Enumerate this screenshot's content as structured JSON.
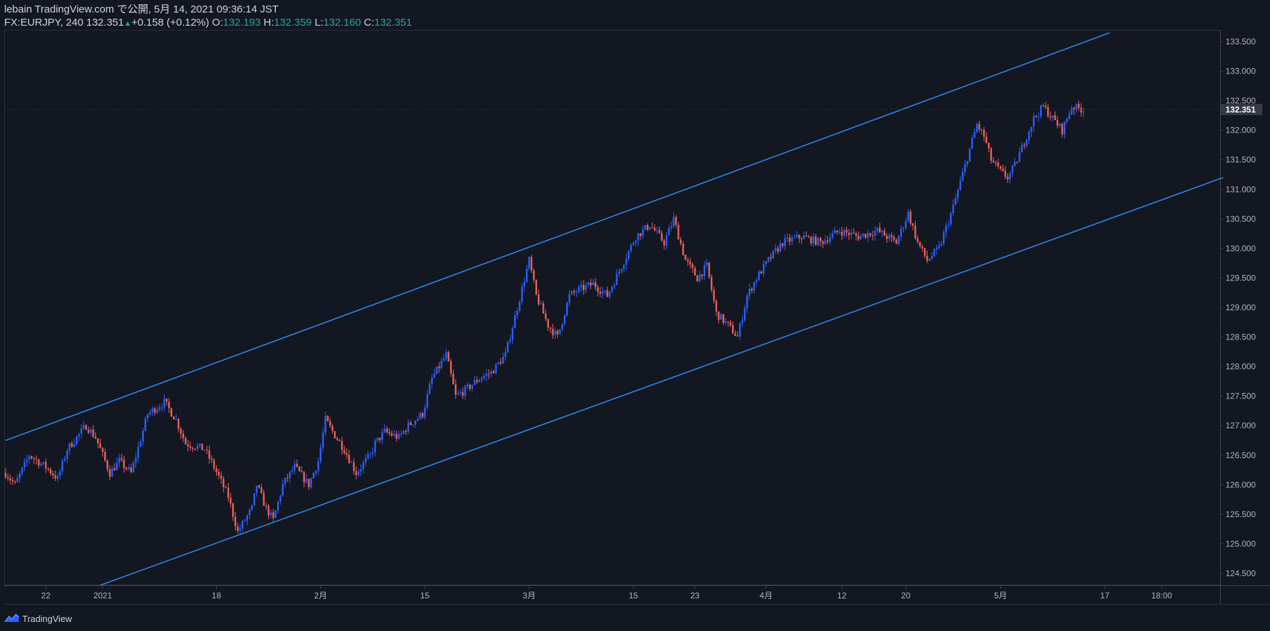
{
  "header": {
    "line1": "lebain TradingView.com で公開, 5月 14, 2021 09:36:14 JST",
    "symbol": "FX:EURJPY, 240",
    "last": "132.351",
    "up_arrow": "▲",
    "change": "+0.158 (+0.12%)",
    "o_label": "O:",
    "o_value": "132.193",
    "h_label": "H:",
    "h_value": "132.359",
    "l_label": "L:",
    "l_value": "132.160",
    "c_label": "C:",
    "c_value": "132.351"
  },
  "footer": {
    "brand": "TradingView",
    "logo_icon": "tradingview-logo-icon"
  },
  "colors": {
    "background": "#131722",
    "up": "#2962ff",
    "down": "#f0625a",
    "channel": "#2f86e4",
    "axis_text": "#b2b5be",
    "price_label_bg": "#363a45"
  },
  "chart_data": {
    "type": "candlestick",
    "symbol": "FX:EURJPY",
    "interval": "240",
    "ylim": [
      124.3,
      133.7
    ],
    "yticks": [
      "124.500",
      "125.000",
      "125.500",
      "126.000",
      "126.500",
      "127.000",
      "127.500",
      "128.000",
      "128.500",
      "129.000",
      "129.500",
      "130.000",
      "130.500",
      "131.000",
      "131.500",
      "132.000",
      "132.500",
      "133.000",
      "133.500"
    ],
    "xticks": [
      {
        "label": "22",
        "idx": 17
      },
      {
        "label": "2021",
        "idx": 41
      },
      {
        "label": "18",
        "idx": 89
      },
      {
        "label": "2月",
        "idx": 133
      },
      {
        "label": "15",
        "idx": 177
      },
      {
        "label": "3月",
        "idx": 221
      },
      {
        "label": "15",
        "idx": 265
      },
      {
        "label": "23",
        "idx": 291
      },
      {
        "label": "4月",
        "idx": 321
      },
      {
        "label": "12",
        "idx": 353
      },
      {
        "label": "20",
        "idx": 380
      },
      {
        "label": "5月",
        "idx": 420
      },
      {
        "label": "17",
        "idx": 464
      },
      {
        "label": "18:00",
        "idx": 488
      }
    ],
    "last_price": "132.351",
    "channel_upper": {
      "start_idx": 0,
      "start_price": 126.75,
      "end_idx": 466,
      "end_price": 133.65
    },
    "channel_lower": {
      "start_idx": 40,
      "start_price": 124.3,
      "end_idx": 514,
      "end_price": 131.2
    },
    "close_path": [
      [
        0,
        126.2
      ],
      [
        4,
        126.0
      ],
      [
        10,
        126.5
      ],
      [
        17,
        126.3
      ],
      [
        22,
        126.1
      ],
      [
        26,
        126.6
      ],
      [
        34,
        127.0
      ],
      [
        38,
        126.8
      ],
      [
        44,
        126.2
      ],
      [
        48,
        126.4
      ],
      [
        53,
        126.2
      ],
      [
        60,
        127.2
      ],
      [
        67,
        127.4
      ],
      [
        72,
        127.1
      ],
      [
        76,
        126.7
      ],
      [
        84,
        126.6
      ],
      [
        88,
        126.3
      ],
      [
        94,
        125.8
      ],
      [
        98,
        125.2
      ],
      [
        104,
        125.6
      ],
      [
        106,
        126.0
      ],
      [
        110,
        125.6
      ],
      [
        113,
        125.4
      ],
      [
        117,
        126.0
      ],
      [
        122,
        126.3
      ],
      [
        128,
        126.0
      ],
      [
        132,
        126.4
      ],
      [
        135,
        127.1
      ],
      [
        138,
        126.9
      ],
      [
        143,
        126.6
      ],
      [
        148,
        126.2
      ],
      [
        154,
        126.5
      ],
      [
        156,
        126.7
      ],
      [
        160,
        126.9
      ],
      [
        166,
        126.8
      ],
      [
        170,
        127.0
      ],
      [
        176,
        127.2
      ],
      [
        180,
        127.8
      ],
      [
        186,
        128.2
      ],
      [
        190,
        127.5
      ],
      [
        194,
        127.6
      ],
      [
        200,
        127.8
      ],
      [
        205,
        127.9
      ],
      [
        211,
        128.2
      ],
      [
        216,
        129.0
      ],
      [
        221,
        129.8
      ],
      [
        224,
        129.2
      ],
      [
        229,
        128.7
      ],
      [
        233,
        128.5
      ],
      [
        238,
        129.2
      ],
      [
        242,
        129.3
      ],
      [
        248,
        129.4
      ],
      [
        254,
        129.2
      ],
      [
        260,
        129.7
      ],
      [
        266,
        130.2
      ],
      [
        272,
        130.4
      ],
      [
        278,
        130.1
      ],
      [
        282,
        130.5
      ],
      [
        287,
        129.8
      ],
      [
        292,
        129.5
      ],
      [
        296,
        129.7
      ],
      [
        300,
        128.9
      ],
      [
        305,
        128.7
      ],
      [
        309,
        128.5
      ],
      [
        313,
        129.2
      ],
      [
        317,
        129.5
      ],
      [
        322,
        129.8
      ],
      [
        328,
        130.1
      ],
      [
        336,
        130.2
      ],
      [
        344,
        130.1
      ],
      [
        352,
        130.3
      ],
      [
        360,
        130.2
      ],
      [
        368,
        130.3
      ],
      [
        376,
        130.1
      ],
      [
        381,
        130.6
      ],
      [
        385,
        130.1
      ],
      [
        389,
        129.8
      ],
      [
        394,
        130.0
      ],
      [
        400,
        130.7
      ],
      [
        405,
        131.4
      ],
      [
        410,
        132.1
      ],
      [
        413,
        131.9
      ],
      [
        416,
        131.5
      ],
      [
        420,
        131.3
      ],
      [
        423,
        131.2
      ],
      [
        426,
        131.4
      ],
      [
        430,
        131.8
      ],
      [
        434,
        132.2
      ],
      [
        438,
        132.4
      ],
      [
        442,
        132.2
      ],
      [
        446,
        132.0
      ],
      [
        450,
        132.4
      ],
      [
        455,
        132.35
      ]
    ]
  }
}
